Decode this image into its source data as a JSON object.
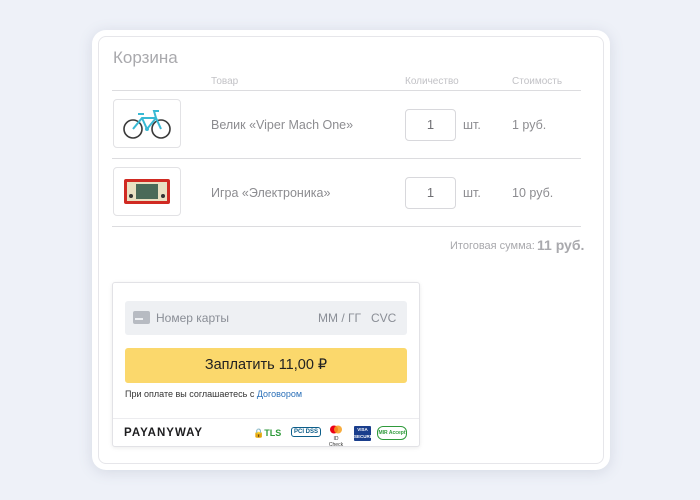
{
  "cart": {
    "title": "Корзина",
    "headers": {
      "product": "Товар",
      "quantity": "Количество",
      "cost": "Стоимость"
    },
    "items": [
      {
        "name": "Велик «Viper Mach One»",
        "quantity": "1",
        "unit": "шт.",
        "price": "1 руб.",
        "image": "bicycle-image"
      },
      {
        "name": "Игра «Электроника»",
        "quantity": "1",
        "unit": "шт.",
        "price": "10 руб.",
        "image": "handheld-game-image"
      }
    ],
    "total_label": "Итоговая сумма:",
    "total_value": "11 руб."
  },
  "payment": {
    "card_number_placeholder": "Номер карты",
    "expiry_placeholder": "ММ / ГГ",
    "cvc_placeholder": "CVC",
    "pay_button": "Заплатить 11,00 ₽",
    "agreement_text": "При оплате вы соглашаетесь с",
    "agreement_link": "Договором",
    "brand": "PAYANYWAY",
    "badges": {
      "tls": "TLS",
      "pci": "PCI DSS",
      "mastercard": "ID Check",
      "visa": "VISA SECURE",
      "mir": "MIR Accept"
    },
    "colors": {
      "button": "#fbd86c",
      "link": "#2a6fb8"
    }
  }
}
